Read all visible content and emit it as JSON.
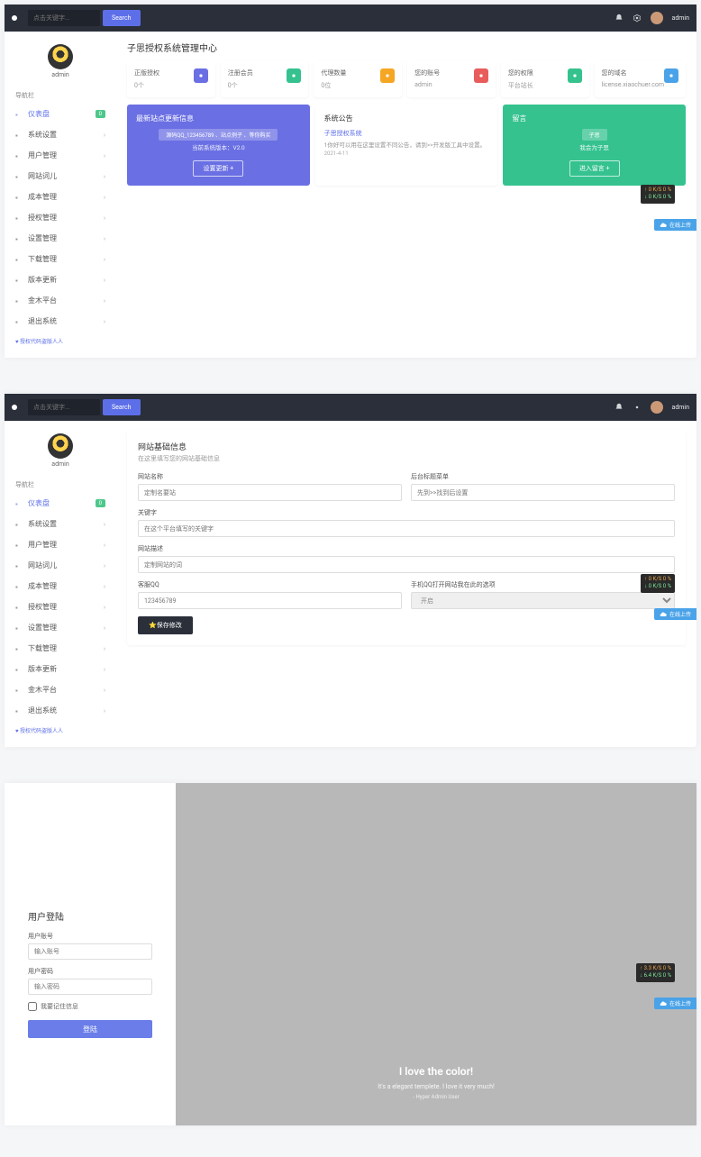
{
  "topnav": {
    "search_placeholder": "点击关键字...",
    "search_btn": "Search",
    "username": "admin"
  },
  "sidebar": {
    "name": "admin",
    "header": "导航栏",
    "items": [
      {
        "icon": "dashboard",
        "label": "仪表盘",
        "badge": "0",
        "active": true
      },
      {
        "icon": "settings",
        "label": "系统设置"
      },
      {
        "icon": "users",
        "label": "用户管理"
      },
      {
        "icon": "grid",
        "label": "网站词儿"
      },
      {
        "icon": "box",
        "label": "成本管理"
      },
      {
        "icon": "shield",
        "label": "授权管理"
      },
      {
        "icon": "file",
        "label": "设置管理"
      },
      {
        "icon": "download",
        "label": "下载管理"
      },
      {
        "icon": "tag",
        "label": "版本更新"
      },
      {
        "icon": "heart",
        "label": "金木平台"
      },
      {
        "icon": "logout",
        "label": "退出系统"
      }
    ],
    "foot": "♥ 授权代码盗版人人"
  },
  "dashboard": {
    "title": "子思授权系统管理中心",
    "stats": [
      {
        "label": "正版授权",
        "value": "0个",
        "color": "#6a6fe3",
        "icon": "shield"
      },
      {
        "label": "注册会员",
        "value": "0个",
        "color": "#35c28f",
        "icon": "info"
      },
      {
        "label": "代理数量",
        "value": "0位",
        "color": "#f5a623",
        "icon": "user"
      },
      {
        "label": "您的账号",
        "value": "admin",
        "color": "#e85c5c",
        "icon": "lock"
      },
      {
        "label": "您的权限",
        "value": "平台站长",
        "color": "#35c28f",
        "icon": "check"
      },
      {
        "label": "您的域名",
        "value": "license.xiaochuer.com",
        "color": "#4aa3e8",
        "icon": "cloud"
      }
    ],
    "cards": {
      "update": {
        "title": "最新站点更新信息",
        "sub": "源码QQ_123456789 、站点例子 、等你购买",
        "ver": "当前系统版本：V2.0",
        "btn": "设置更新 +"
      },
      "announce": {
        "title": "系统公告",
        "link": "子思授权系统",
        "text": "1你好可以用在这里设置不同公告，请到>>开发版工具中设置。",
        "date": "2021-4-11"
      },
      "msg": {
        "title": "留言",
        "tag": "子思",
        "sub": "我会为子思",
        "btn": "进入留言 +"
      }
    }
  },
  "floatbadge": {
    "up": "↑ 0 K/S 0 %",
    "down": "↓ 0 K/S 0 %"
  },
  "floattag": "在线上传",
  "form": {
    "title": "网站基础信息",
    "subtitle": "在这里填写您的网站基础信息",
    "fields": {
      "sitename": {
        "label": "网站名称",
        "placeholder": "定制名要站"
      },
      "sitename2": {
        "label": "后台标题菜单",
        "placeholder": "先到>>找到后设置"
      },
      "keyword": {
        "label": "关键字",
        "placeholder": "在这个平台填写的关键字"
      },
      "desc": {
        "label": "网站描述",
        "placeholder": "定制网站的词"
      },
      "qq": {
        "label": "客服QQ",
        "placeholder": "123456789"
      },
      "qqsel": {
        "label": "手机QQ打开网站我在此的选项",
        "value": "开启"
      }
    },
    "save": "⭐保存修改"
  },
  "login": {
    "title": "用户登陆",
    "user_label": "用户账号",
    "user_ph": "输入账号",
    "pass_label": "用户密码",
    "pass_ph": "输入密码",
    "remember": "我要记住信息",
    "btn": "登陆",
    "hero_title": "I love the color!",
    "hero_sub": "It's a elegant templete. I love it very much!",
    "hero_sig": "- Hyper Admin User"
  },
  "badge2": {
    "up": "↑ 3.3 K/S 0 %",
    "down": "↓ 6.4 K/S 0 %"
  }
}
